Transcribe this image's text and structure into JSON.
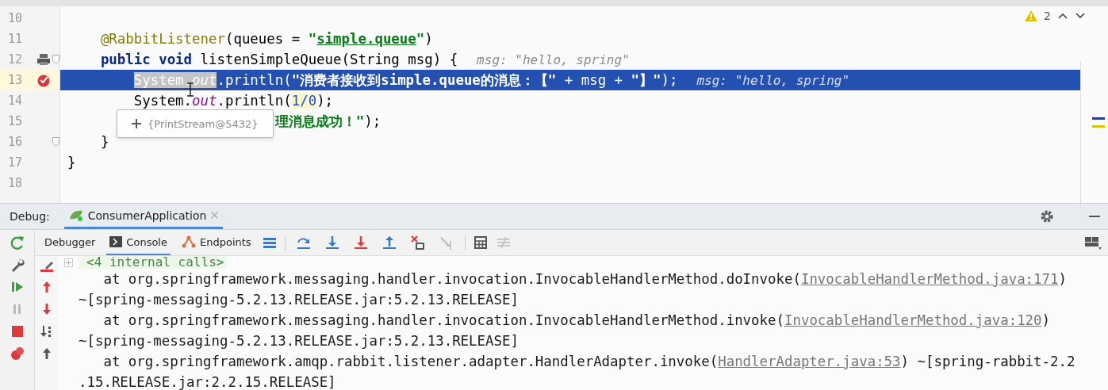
{
  "editor": {
    "inspection": {
      "count": "2"
    },
    "lines": [
      {
        "number": "10",
        "breakpoint": false,
        "selected": false,
        "fold": false
      },
      {
        "number": "11",
        "breakpoint": false,
        "selected": false,
        "fold": false,
        "tokens": [
          {
            "text": "    @RabbitListener",
            "kind": "annotation"
          },
          {
            "text": "(queues = ",
            "kind": "plain"
          },
          {
            "text": "\"",
            "kind": "string"
          },
          {
            "text": "simple.queue",
            "kind": "ref"
          },
          {
            "text": "\"",
            "kind": "string"
          },
          {
            "text": ")",
            "kind": "plain"
          }
        ]
      },
      {
        "number": "12",
        "breakpoint": false,
        "selected": false,
        "fold": true,
        "tokens": [
          {
            "text": "    public void ",
            "kind": "keyword"
          },
          {
            "text": "listenSimpleQueue(String msg) {",
            "kind": "plain"
          },
          {
            "text": "msg: \"hello, spring\"",
            "kind": "hint"
          }
        ]
      },
      {
        "number": "13",
        "breakpoint": true,
        "selected": true,
        "fold": false,
        "tokens": [
          {
            "text": "        System.",
            "kind": "selword"
          },
          {
            "text": "out",
            "kind": "selfield"
          },
          {
            "text": ".println(",
            "kind": "plain"
          },
          {
            "text": "\"消费者接收到simple.queue的消息：【\"",
            "kind": "string"
          },
          {
            "text": " + msg + ",
            "kind": "plain"
          },
          {
            "text": "\"】\"",
            "kind": "string"
          },
          {
            "text": ");",
            "kind": "plain"
          },
          {
            "text": "msg: \"hello, spring\"",
            "kind": "hint"
          }
        ]
      },
      {
        "number": "14",
        "breakpoint": false,
        "selected": false,
        "fold": false,
        "tokens": [
          {
            "text": "        System.",
            "kind": "plain"
          },
          {
            "text": "out",
            "kind": "field"
          },
          {
            "text": ".println(",
            "kind": "plain"
          },
          {
            "text": "1/0",
            "kind": "number"
          },
          {
            "text": ");",
            "kind": "plain"
          }
        ]
      },
      {
        "number": "15",
        "breakpoint": false,
        "selected": false,
        "fold": false,
        "tokens": [
          {
            "text": "                         理消息成功！\"",
            "kind": "string"
          },
          {
            "text": ");",
            "kind": "plain"
          }
        ]
      },
      {
        "number": "16",
        "breakpoint": false,
        "selected": false,
        "fold": true,
        "tokens": [
          {
            "text": "    }",
            "kind": "plain"
          }
        ]
      },
      {
        "number": "17",
        "breakpoint": false,
        "selected": false,
        "fold": false,
        "tokens": [
          {
            "text": "}",
            "kind": "plain"
          }
        ]
      },
      {
        "number": "18",
        "breakpoint": false,
        "selected": false,
        "fold": false
      }
    ],
    "popup": {
      "value": "{PrintStream@5432}"
    }
  },
  "debug": {
    "label": "Debug:",
    "tabs": [
      {
        "label": "ConsumerApplication",
        "selected": true
      }
    ],
    "toolbar_tabs": [
      {
        "label": "Debugger",
        "selected": false
      },
      {
        "label": "Console",
        "selected": true
      },
      {
        "label": "Endpoints",
        "selected": false
      }
    ],
    "console": [
      {
        "kind": "fold",
        "segments": [
          {
            "text": "<4 internal calls>",
            "kind": "plain"
          }
        ]
      },
      {
        "kind": "line",
        "segments": [
          {
            "text": "   at org.springframework.messaging.handler.invocation.InvocableHandlerMethod.doInvoke(",
            "kind": "plain"
          },
          {
            "text": "InvocableHandlerMethod.java:171",
            "kind": "link"
          },
          {
            "text": ")",
            "kind": "plain"
          }
        ]
      },
      {
        "kind": "line",
        "segments": [
          {
            "text": "~[spring-messaging-5.2.13.RELEASE.jar:5.2.13.RELEASE]",
            "kind": "plain"
          }
        ]
      },
      {
        "kind": "line",
        "segments": [
          {
            "text": "   at org.springframework.messaging.handler.invocation.InvocableHandlerMethod.invoke(",
            "kind": "plain"
          },
          {
            "text": "InvocableHandlerMethod.java:120",
            "kind": "link"
          },
          {
            "text": ")",
            "kind": "plain"
          }
        ]
      },
      {
        "kind": "line",
        "segments": [
          {
            "text": "~[spring-messaging-5.2.13.RELEASE.jar:5.2.13.RELEASE]",
            "kind": "plain"
          }
        ]
      },
      {
        "kind": "line",
        "segments": [
          {
            "text": "   at org.springframework.amqp.rabbit.listener.adapter.HandlerAdapter.invoke(",
            "kind": "plain"
          },
          {
            "text": "HandlerAdapter.java:53",
            "kind": "link"
          },
          {
            "text": ") ~[spring-rabbit-2.2",
            "kind": "plain"
          }
        ]
      },
      {
        "kind": "line",
        "segments": [
          {
            "text": ".15.RELEASE.jar:2.2.15.RELEASE]",
            "kind": "plain"
          }
        ]
      }
    ]
  }
}
